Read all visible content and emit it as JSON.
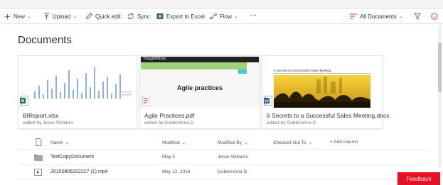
{
  "toolbar": {
    "new_label": "New",
    "upload_label": "Upload",
    "quick_edit_label": "Quick edit",
    "sync_label": "Sync",
    "export_label": "Export to Excel",
    "flow_label": "Flow",
    "more_label": "···",
    "view_label": "All Documents"
  },
  "page": {
    "title": "Documents"
  },
  "tiles": [
    {
      "name": "BIReport.xlsx",
      "meta": "edited by Jesse Williams",
      "icon": "excel-file-icon"
    },
    {
      "name": "Agile Practices.pdf",
      "meta": "edited by Gobikrishna D",
      "icon": "pdf-file-icon",
      "thumb_brand": "ThoughtWorks",
      "thumb_title": "Agile practices"
    },
    {
      "name": "6 Secrets to a Successful Sales Meeting.docx",
      "meta": "edited by Gobikrishna D",
      "icon": "word-file-icon",
      "thumb_title": "6 Secrets to a Successful Sales Meeting"
    }
  ],
  "list": {
    "columns": {
      "name": "Name",
      "modified": "Modified",
      "modified_by": "Modified By",
      "checked_out_to": "Checked Out To",
      "add_column": "+ Add column"
    },
    "rows": [
      {
        "name": "TestCopyDocument",
        "modified": "May 3",
        "modified_by": "Jesse Williams",
        "icon": "folder-icon"
      },
      {
        "name": "20150806202227 (1).mp4",
        "modified": "May 12, 2016",
        "modified_by": "Gobikrishna D",
        "icon": "video-file-icon"
      }
    ]
  },
  "feedback_label": "Feedback",
  "colors": {
    "accent_red": "#e81123",
    "excel_green": "#217346",
    "word_blue": "#2b579a",
    "pdf_red": "#c4262e",
    "chart_blue": "#8fb0dc"
  }
}
